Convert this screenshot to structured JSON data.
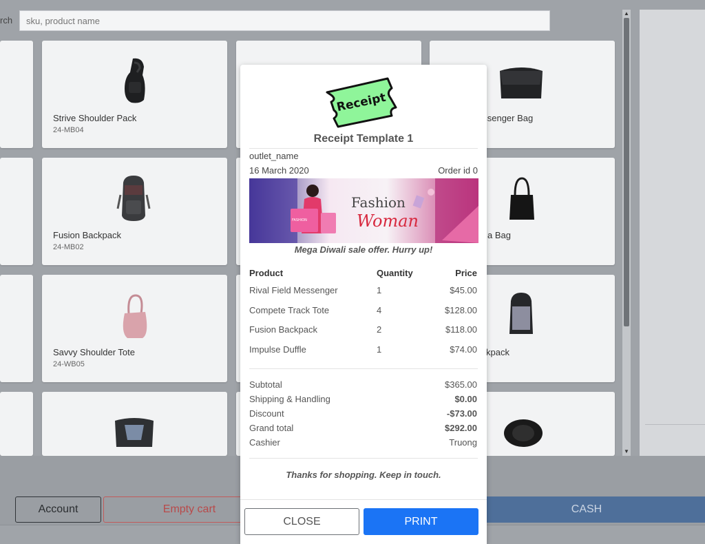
{
  "search": {
    "label": "rch",
    "placeholder": "sku, product name"
  },
  "products": [
    {
      "name": "Strive Shoulder Pack",
      "sku": "24-MB04"
    },
    {
      "name": "essenger Bag",
      "sku": ""
    },
    {
      "name": "Fusion Backpack",
      "sku": "24-MB02"
    },
    {
      "name": "a Bag",
      "sku": ""
    },
    {
      "name": "Savvy Shoulder Tote",
      "sku": "24-WB05"
    },
    {
      "name": "kpack",
      "sku": ""
    }
  ],
  "footer": {
    "account_label": "Account",
    "empty_cart_label": "Empty cart",
    "cash_label": "CASH"
  },
  "receipt": {
    "logo_text": "Receipt",
    "title": "Receipt Template 1",
    "outlet_name": "outlet_name",
    "date": "16 March 2020",
    "order_id": "Order id 0",
    "banner": {
      "word1": "Fashion",
      "word2": "Woman",
      "tag": "FASHION"
    },
    "offer": "Mega Diwali sale offer. Hurry up!",
    "columns": {
      "product": "Product",
      "quantity": "Quantity",
      "price": "Price"
    },
    "items": [
      {
        "product": "Rival Field Messenger",
        "quantity": "1",
        "price": "$45.00"
      },
      {
        "product": "Compete Track Tote",
        "quantity": "4",
        "price": "$128.00"
      },
      {
        "product": "Fusion Backpack",
        "quantity": "2",
        "price": "$118.00"
      },
      {
        "product": "Impulse Duffle",
        "quantity": "1",
        "price": "$74.00"
      }
    ],
    "summary": {
      "subtotal_label": "Subtotal",
      "subtotal": "$365.00",
      "shipping_label": "Shipping & Handling",
      "shipping": "$0.00",
      "discount_label": "Discount",
      "discount": "-$73.00",
      "grand_total_label": "Grand total",
      "grand_total": "$292.00",
      "cashier_label": "Cashier",
      "cashier": "Truong"
    },
    "thanks": "Thanks for shopping. Keep in touch.",
    "close_label": "CLOSE",
    "print_label": "PRINT"
  },
  "colors": {
    "print_button": "#1b74f5",
    "cash_button": "#4e6f9a",
    "logo_ticket": "#8ff59a",
    "empty_cart": "#b84a4a"
  }
}
